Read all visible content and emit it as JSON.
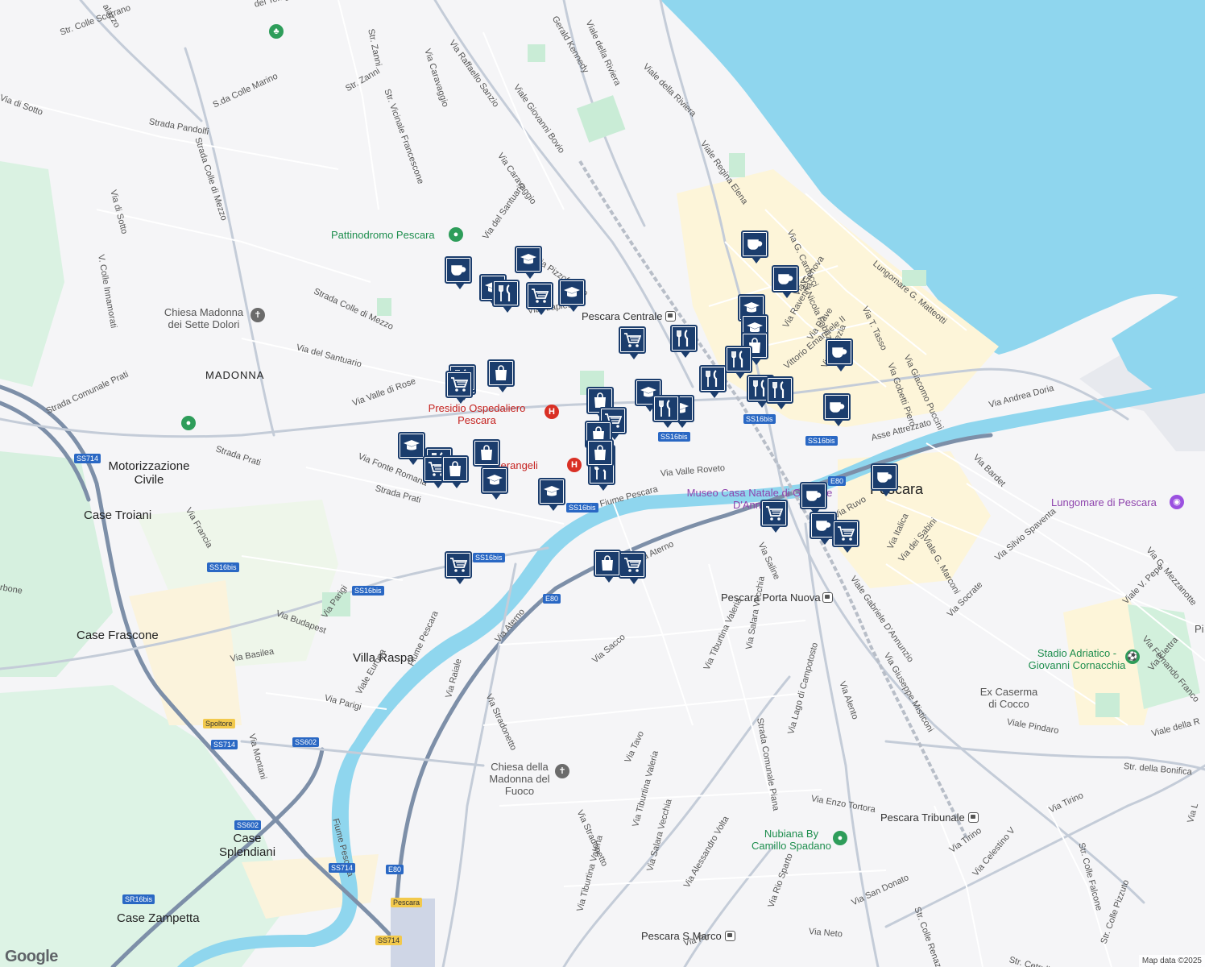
{
  "attribution": "Map data ©2025",
  "google_logo": "Google",
  "colors": {
    "water": "#8fd6ee",
    "land": "#f5f5f7",
    "park": "#c9ecd6",
    "road": "#ffffff",
    "arterial": "#c4ccd8",
    "highway": "#7d8fa8",
    "zone": "#fdf5d9",
    "marker": "#1b3d6d"
  },
  "places": {
    "madonna": "MADONNA",
    "motorizzazione": "Motorizzazione Civile",
    "case_troiani": "Case Troiani",
    "case_frascone": "Case Frascone",
    "villa_raspa": "Villa Raspa",
    "case_splendiani": "Case Splendiani",
    "case_zampetta": "Case Zampetta",
    "pescara": "Pescara"
  },
  "pois": {
    "pattinodromo": "Pattinodromo Pescara",
    "chiesa_sette_dolori": "Chiesa Madonna dei Sette Dolori",
    "presidio": "Presidio Ospedaliero Pescara",
    "pierangeli": "Pierangeli",
    "museo": "Museo Casa Natale di Gabriele D'Annunzio",
    "lungomare": "Lungomare di Pescara",
    "stadio": "Stadio Adriatico - Giovanni Cornacchia",
    "caserma": "Ex Caserma di Cocco",
    "chiesa_fuoco": "Chiesa della Madonna del Fuoco",
    "nubiana": "Nubiana By Camillo Spadano",
    "partial_right": "Pi"
  },
  "transit": {
    "centrale": "Pescara Centrale",
    "porta_nuova": "Pescara Porta Nuova",
    "tribunale": "Pescara Tribunale",
    "san_marco": "Pescara S.Marco"
  },
  "streets": [
    "Str. Colle Scorrano",
    "Via di Sotto",
    "Strada Pandolfi",
    "S.da Colle Marino",
    "Strada Colle di Mezzo",
    "Via di Sotto",
    "V. Colle Innamorati",
    "Str. Zanni",
    "Str. Zanni",
    "Str. Vicinale Francescone",
    "Via Caravaggio",
    "Via Raffaello Sanzio",
    "Viale Giovanni Bovio",
    "Via Caravaggio",
    "Viale della Riviera",
    "Viale della Riviera",
    "Viale Regina Elena",
    "Via G. Carducci",
    "Lungomare G. Matteotti",
    "Via Nicola Fabrizi",
    "Via T. Tasso",
    "Via Giacomo Puccini",
    "Via Gobetti Piero",
    "Via Genova",
    "Via Ravenna",
    "Via del Santuario",
    "Via Pizzoferrato",
    "Strada Colle di Mezzo",
    "Via Arapietra",
    "Via del Santuario",
    "Via Valle di Rose",
    "Strada Comunale Prati",
    "Strada Prati",
    "Via Fonte Romana",
    "Strada Prati",
    "Via Francia",
    "Via Valle Roveto",
    "Fiume Pescara",
    "Via Andrea Doria",
    "Asse Attrezzato",
    "Via Bardet",
    "Viale G. Marconi",
    "Via Italica",
    "Via dei Sabini",
    "Via Silvio Spaventa",
    "Via Socrate",
    "Via G. Mezzanotte",
    "Viale V. Pepe",
    "Via Fernando Franco",
    "Via Elettra",
    "Viale Gabriele D'Annunzio",
    "Via Giuseppe Misticoni",
    "Viale Pindaro",
    "Viale della R",
    "Str. della Bonifica",
    "Via Aterno",
    "Via Saline",
    "Via Budapest",
    "Via Parigi",
    "Via Basilea",
    "Via Parigi",
    "Viale Europa",
    "Fiume Pescara",
    "Via Montani",
    "Via Aterno",
    "Via Raiale",
    "Via Stradonetto",
    "Via Sacco",
    "Via Tiburtina Valeria",
    "Via Salara Vecchia",
    "Strada Comunale Piana",
    "Via Lago di Campotosto",
    "Via Alento",
    "Via Tavo",
    "Via Tiburtina Valeria",
    "Via Stradonetto",
    "Via Enzo Tortora",
    "Via Tirino",
    "Via Tirino",
    "Str. Colle Falcone",
    "Via Celestino V",
    "Fiume Pescara",
    "Via Salara Vecchia",
    "Via Alessandro Volta",
    "Via Tiburtina Valeria",
    "Via Rio Sparto",
    "Via Neto",
    "Via San Donato",
    "Str. Colle Renazzo",
    "Via Po",
    "Str. Cetrullo",
    "Str. Colle Pizzuto",
    "Vittorio Emanuele II",
    "Via Venezia",
    "Via Ruvo",
    "Gerald Kennedy",
    "del Telegrafo",
    "alazzo",
    "Via Piave",
    "rbone",
    "Via L"
  ],
  "shields": [
    "SS714",
    "SS16bis",
    "SS16bis",
    "SS16bis",
    "SS16bis",
    "SS16bis",
    "SS16bis",
    "SS16bis",
    "E80",
    "E80",
    "SS602",
    "SS714",
    "SS602",
    "SS714",
    "E80",
    "SR16bis",
    "Pescara",
    "SS714",
    "Spoltore"
  ],
  "markers": [
    {
      "icon": "cafe-icon"
    },
    {
      "icon": "school-icon"
    },
    {
      "icon": "school-icon"
    },
    {
      "icon": "restaurant-icon"
    },
    {
      "icon": "grocery-icon"
    },
    {
      "icon": "school-icon"
    },
    {
      "icon": "grocery-icon"
    },
    {
      "icon": "restaurant-icon"
    },
    {
      "icon": "restaurant-icon"
    },
    {
      "icon": "grocery-icon"
    },
    {
      "icon": "grocery-icon"
    },
    {
      "icon": "shopping-bag-icon"
    },
    {
      "icon": "shopping-bag-icon"
    },
    {
      "icon": "school-icon"
    },
    {
      "icon": "restaurant-icon"
    },
    {
      "icon": "grocery-icon"
    },
    {
      "icon": "school-icon"
    },
    {
      "icon": "shopping-bag-icon"
    },
    {
      "icon": "restaurant-icon"
    },
    {
      "icon": "restaurant-icon"
    },
    {
      "icon": "school-icon"
    },
    {
      "icon": "shopping-bag-icon"
    },
    {
      "icon": "grocery-icon"
    },
    {
      "icon": "shopping-bag-icon"
    },
    {
      "icon": "shopping-bag-icon"
    },
    {
      "icon": "school-icon"
    },
    {
      "icon": "school-icon"
    },
    {
      "icon": "grocery-icon"
    },
    {
      "icon": "grocery-icon"
    },
    {
      "icon": "shopping-bag-icon"
    },
    {
      "icon": "grocery-icon"
    },
    {
      "icon": "cafe-icon"
    },
    {
      "icon": "cafe-icon"
    },
    {
      "icon": "school-icon"
    },
    {
      "icon": "school-icon"
    },
    {
      "icon": "shopping-bag-icon"
    },
    {
      "icon": "restaurant-icon"
    },
    {
      "icon": "restaurant-icon"
    },
    {
      "icon": "restaurant-icon"
    },
    {
      "icon": "restaurant-icon"
    },
    {
      "icon": "cafe-icon"
    },
    {
      "icon": "cafe-icon"
    },
    {
      "icon": "cafe-icon"
    },
    {
      "icon": "cafe-icon"
    },
    {
      "icon": "cafe-icon"
    },
    {
      "icon": "grocery-icon"
    },
    {
      "icon": "restaurant-icon"
    }
  ]
}
